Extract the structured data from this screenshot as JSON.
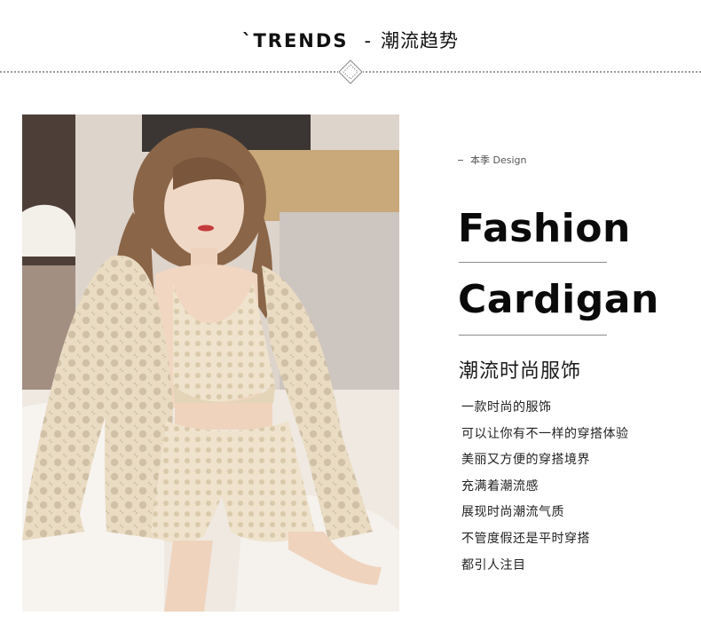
{
  "header": {
    "title_en": "`TRENDS",
    "separator": "-",
    "title_cn": "潮流趋势"
  },
  "hero_image": {
    "icon": "fashion-model-photo"
  },
  "copy": {
    "eyebrow": "本季 Design",
    "headline_1": "Fashion",
    "headline_2": "Cardigan",
    "subhead": "潮流时尚服饰",
    "lines": [
      "一款时尚的服饰",
      "可以让你有不一样的穿搭体验",
      "美丽又方便的穿搭境界",
      "充满着潮流感",
      "展现时尚潮流气质",
      "不管度假还是平时穿搭",
      "都引人注目"
    ]
  }
}
